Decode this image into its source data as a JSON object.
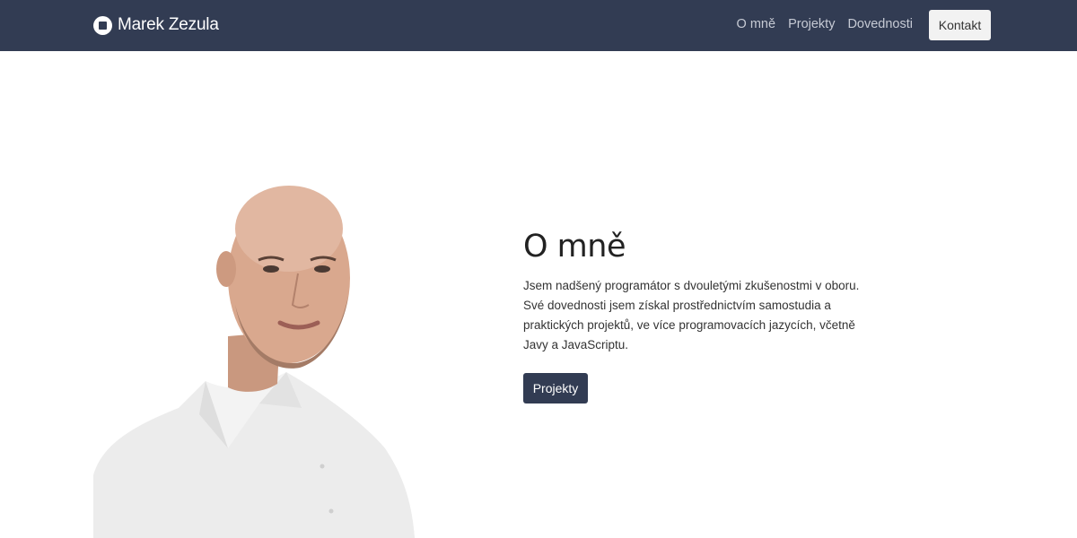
{
  "navbar": {
    "brand_name": "Marek Zezula",
    "brand_icon": "square-circle-logo-icon",
    "links": [
      {
        "label": "O mně"
      },
      {
        "label": "Projekty"
      },
      {
        "label": "Dovednosti"
      }
    ],
    "contact_label": "Kontakt"
  },
  "hero": {
    "photo_alt": "portrait-photo",
    "title": "O mně",
    "paragraph": "Jsem nadšený programátor s dvouletými zkušenostmi v oboru. Své dovednosti jsem získal prostřednictvím samostudia a praktických projektů, ve více programovacích jazycích, včetně Javy a JavaScriptu.",
    "button_label": "Projekty"
  },
  "colors": {
    "navbar_bg": "#323c53",
    "nav_link": "#c6cad4",
    "button_bg": "#323c53",
    "contact_bg": "#f2f2f2"
  }
}
